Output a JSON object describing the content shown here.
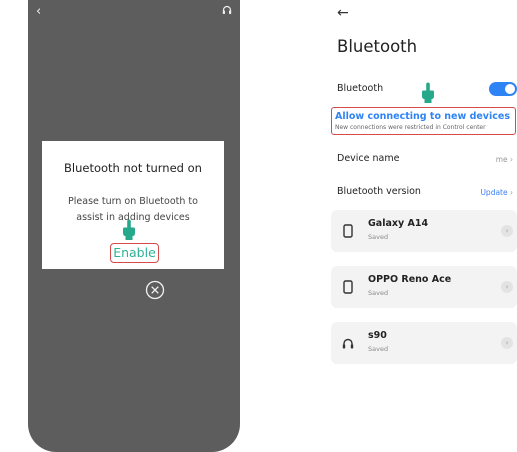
{
  "left_screen": {
    "dialog": {
      "title": "Bluetooth not turned on",
      "message": "Please turn on Bluetooth to assist in adding devices",
      "enable_label": "Enable"
    },
    "icons": [
      "back-arrow",
      "headset",
      "pointing-hand",
      "close-circle"
    ]
  },
  "right_screen": {
    "back_glyph": "←",
    "title": "Bluetooth",
    "bluetooth_toggle": {
      "label": "Bluetooth",
      "on": true,
      "color": "#2f84f5"
    },
    "allow_connecting": {
      "title": "Allow connecting to new devices",
      "subtitle": "New connections were restricted in Control center"
    },
    "device_name": {
      "label": "Device name",
      "value": "me",
      "chevron": "›"
    },
    "bluetooth_version": {
      "label": "Bluetooth version",
      "value": "Update",
      "chevron": "›"
    },
    "devices": [
      {
        "name": "Galaxy A14",
        "status": "Saved",
        "icon": "phone"
      },
      {
        "name": "OPPO Reno Ace",
        "status": "Saved",
        "icon": "phone"
      },
      {
        "name": "s90",
        "status": "Saved",
        "icon": "headset"
      }
    ],
    "info_glyph": "›"
  },
  "colors": {
    "accent_blue": "#2f84f5",
    "highlight_red": "#d84a4a",
    "enable_green": "#2fb195",
    "hand_teal": "#26a88a",
    "overlay_gray": "#5d5d5d"
  }
}
